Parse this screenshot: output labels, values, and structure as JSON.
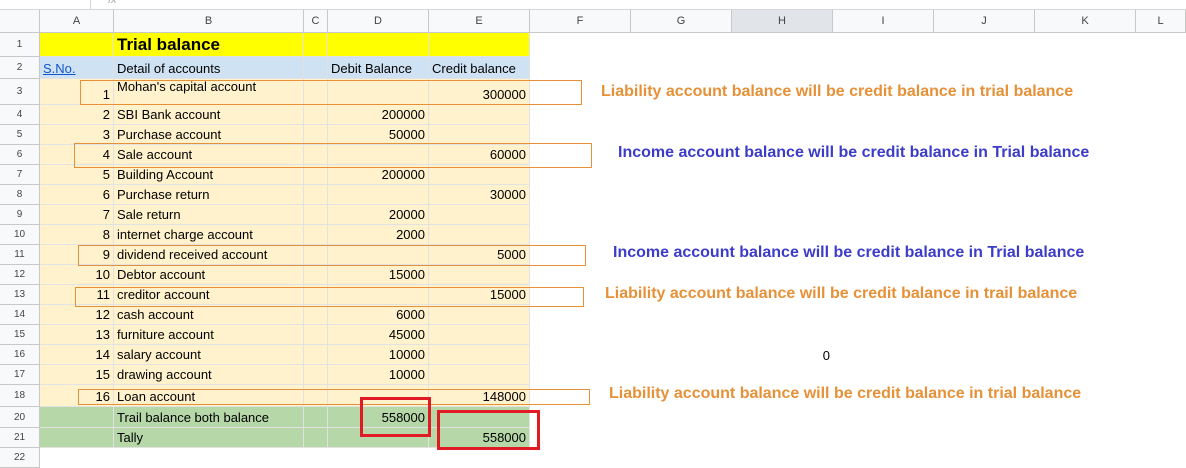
{
  "formula_bar": {
    "fx": "fx"
  },
  "columns": [
    "A",
    "B",
    "C",
    "D",
    "E",
    "F",
    "G",
    "H",
    "I",
    "J",
    "K",
    "L"
  ],
  "rows": [
    "1",
    "2",
    "3",
    "4",
    "5",
    "6",
    "7",
    "8",
    "9",
    "10",
    "11",
    "12",
    "13",
    "14",
    "15",
    "16",
    "17",
    "18",
    "20",
    "21",
    "22"
  ],
  "sheet": {
    "title": "Trial balance",
    "headers": {
      "sno": "S.No.",
      "detail": "Detail of accounts",
      "debit": "Debit Balance",
      "credit": "Credit balance"
    },
    "entries": [
      {
        "sno": "1",
        "detail": "Mohan's capital account",
        "debit": "",
        "credit": "300000"
      },
      {
        "sno": "2",
        "detail": "SBI Bank account",
        "debit": "200000",
        "credit": ""
      },
      {
        "sno": "3",
        "detail": "Purchase account",
        "debit": "50000",
        "credit": ""
      },
      {
        "sno": "4",
        "detail": "Sale account",
        "debit": "",
        "credit": "60000"
      },
      {
        "sno": "5",
        "detail": "Building Account",
        "debit": "200000",
        "credit": ""
      },
      {
        "sno": "6",
        "detail": "Purchase return",
        "debit": "",
        "credit": "30000"
      },
      {
        "sno": "7",
        "detail": "Sale return",
        "debit": "20000",
        "credit": ""
      },
      {
        "sno": "8",
        "detail": "internet charge account",
        "debit": "2000",
        "credit": ""
      },
      {
        "sno": "9",
        "detail": "dividend received account",
        "debit": "",
        "credit": "5000"
      },
      {
        "sno": "10",
        "detail": "Debtor account",
        "debit": "15000",
        "credit": ""
      },
      {
        "sno": "11",
        "detail": "creditor account",
        "debit": "",
        "credit": "15000"
      },
      {
        "sno": "12",
        "detail": "cash account",
        "debit": "6000",
        "credit": ""
      },
      {
        "sno": "13",
        "detail": "furniture account",
        "debit": "45000",
        "credit": ""
      },
      {
        "sno": "14",
        "detail": "salary account",
        "debit": "10000",
        "credit": ""
      },
      {
        "sno": "15",
        "detail": "drawing account",
        "debit": "10000",
        "credit": ""
      },
      {
        "sno": "16",
        "detail": "Loan account",
        "debit": "",
        "credit": "148000"
      }
    ],
    "totals": {
      "label": "Trail balance both balance",
      "debit": "558000",
      "tally_label": "Tally",
      "credit": "558000"
    },
    "stray_value": "0"
  },
  "annotations": [
    {
      "text": "Liability account  balance will be credit balance in trial  balance",
      "color": "#e69138"
    },
    {
      "text": "Income account  balance will be credit balance in Trial balance",
      "color": "#3c3cc8"
    },
    {
      "text": "Income account  balance will be credit balance in Trial balance",
      "color": "#3c3cc8"
    },
    {
      "text": "Liability account  balance will be credit balance in trail balance",
      "color": "#e69138"
    },
    {
      "text": "Liability account  balance will be credit balance in  trial balance",
      "color": "#e69138"
    }
  ]
}
